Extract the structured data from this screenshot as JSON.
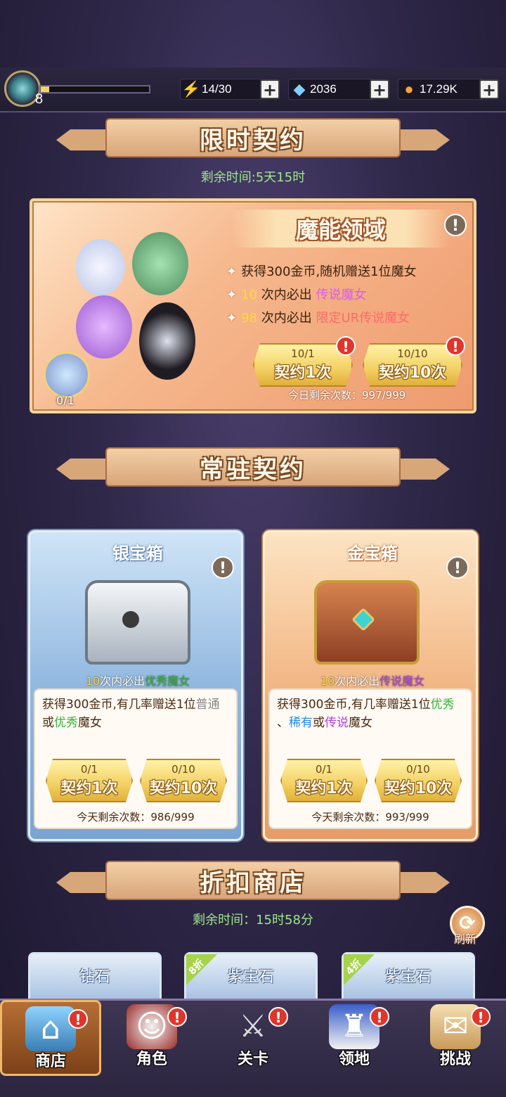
{
  "top": {
    "level": "8",
    "xp_fraction": 0.08,
    "stamina": "14/30",
    "diamonds": "2036",
    "coins": "17.29K"
  },
  "limited": {
    "section_title": "限时契约",
    "remaining_time": "剩余时间:5天15时",
    "banner_name": "魔能领域",
    "line1": "获得300金币,随机赠送1位魔女",
    "line2_num": "10",
    "line2_mid": "次内必出",
    "line2_tag": "传说魔女",
    "line3_num": "98",
    "line3_mid": "次内必出",
    "line3_tag": "限定UR传说魔女",
    "single_cost": "10/1",
    "single_label": "契约1次",
    "ten_cost": "10/10",
    "ten_label": "契约10次",
    "daily_remaining": "今日剩余次数：997/999",
    "avatar_count": "0/1"
  },
  "standard": {
    "section_title": "常驻契约",
    "silver": {
      "title": "银宝箱",
      "g_num": "10",
      "g_mid": "次内必出",
      "g_tag": "优秀魔女",
      "desc_a": "获得300金币,有几率赠送1位",
      "desc_b": "普通",
      "desc_c": "或",
      "desc_d": "优秀",
      "desc_e": "魔女",
      "single_cost": "0/1",
      "single_label": "契约1次",
      "ten_cost": "0/10",
      "ten_label": "契约10次",
      "remaining": "今天剩余次数：986/999"
    },
    "gold": {
      "title": "金宝箱",
      "g_num": "10",
      "g_mid": "次内必出",
      "g_tag": "传说魔女",
      "desc_a": "获得300金币,有几率赠送1位",
      "desc_b": "优秀",
      "desc_c": "、",
      "desc_d": "稀有",
      "desc_e": "或",
      "desc_f": "传说",
      "desc_g": "魔女",
      "single_cost": "0/1",
      "single_label": "契约1次",
      "ten_cost": "0/10",
      "ten_label": "契约10次",
      "remaining": "今天剩余次数：993/999"
    }
  },
  "discount": {
    "section_title": "折扣商店",
    "remaining_time": "剩余时间：15时58分",
    "refresh_label": "刷新",
    "items": [
      {
        "name": "钻石",
        "discount": ""
      },
      {
        "name": "紫宝石",
        "discount": "8折"
      },
      {
        "name": "紫宝石",
        "discount": "4折"
      }
    ]
  },
  "nav": [
    {
      "label": "商店",
      "icon": "shop-icon"
    },
    {
      "label": "角色",
      "icon": "character-icon"
    },
    {
      "label": "关卡",
      "icon": "swords-icon"
    },
    {
      "label": "领地",
      "icon": "castle-icon"
    },
    {
      "label": "挑战",
      "icon": "scroll-icon"
    }
  ],
  "colors": {
    "legend": "#b040e0",
    "excellent": "#35b23b",
    "rare": "#1f8ce6",
    "limited_ur": "#ff6a6a",
    "guarantee_num": "#ffd83a"
  }
}
